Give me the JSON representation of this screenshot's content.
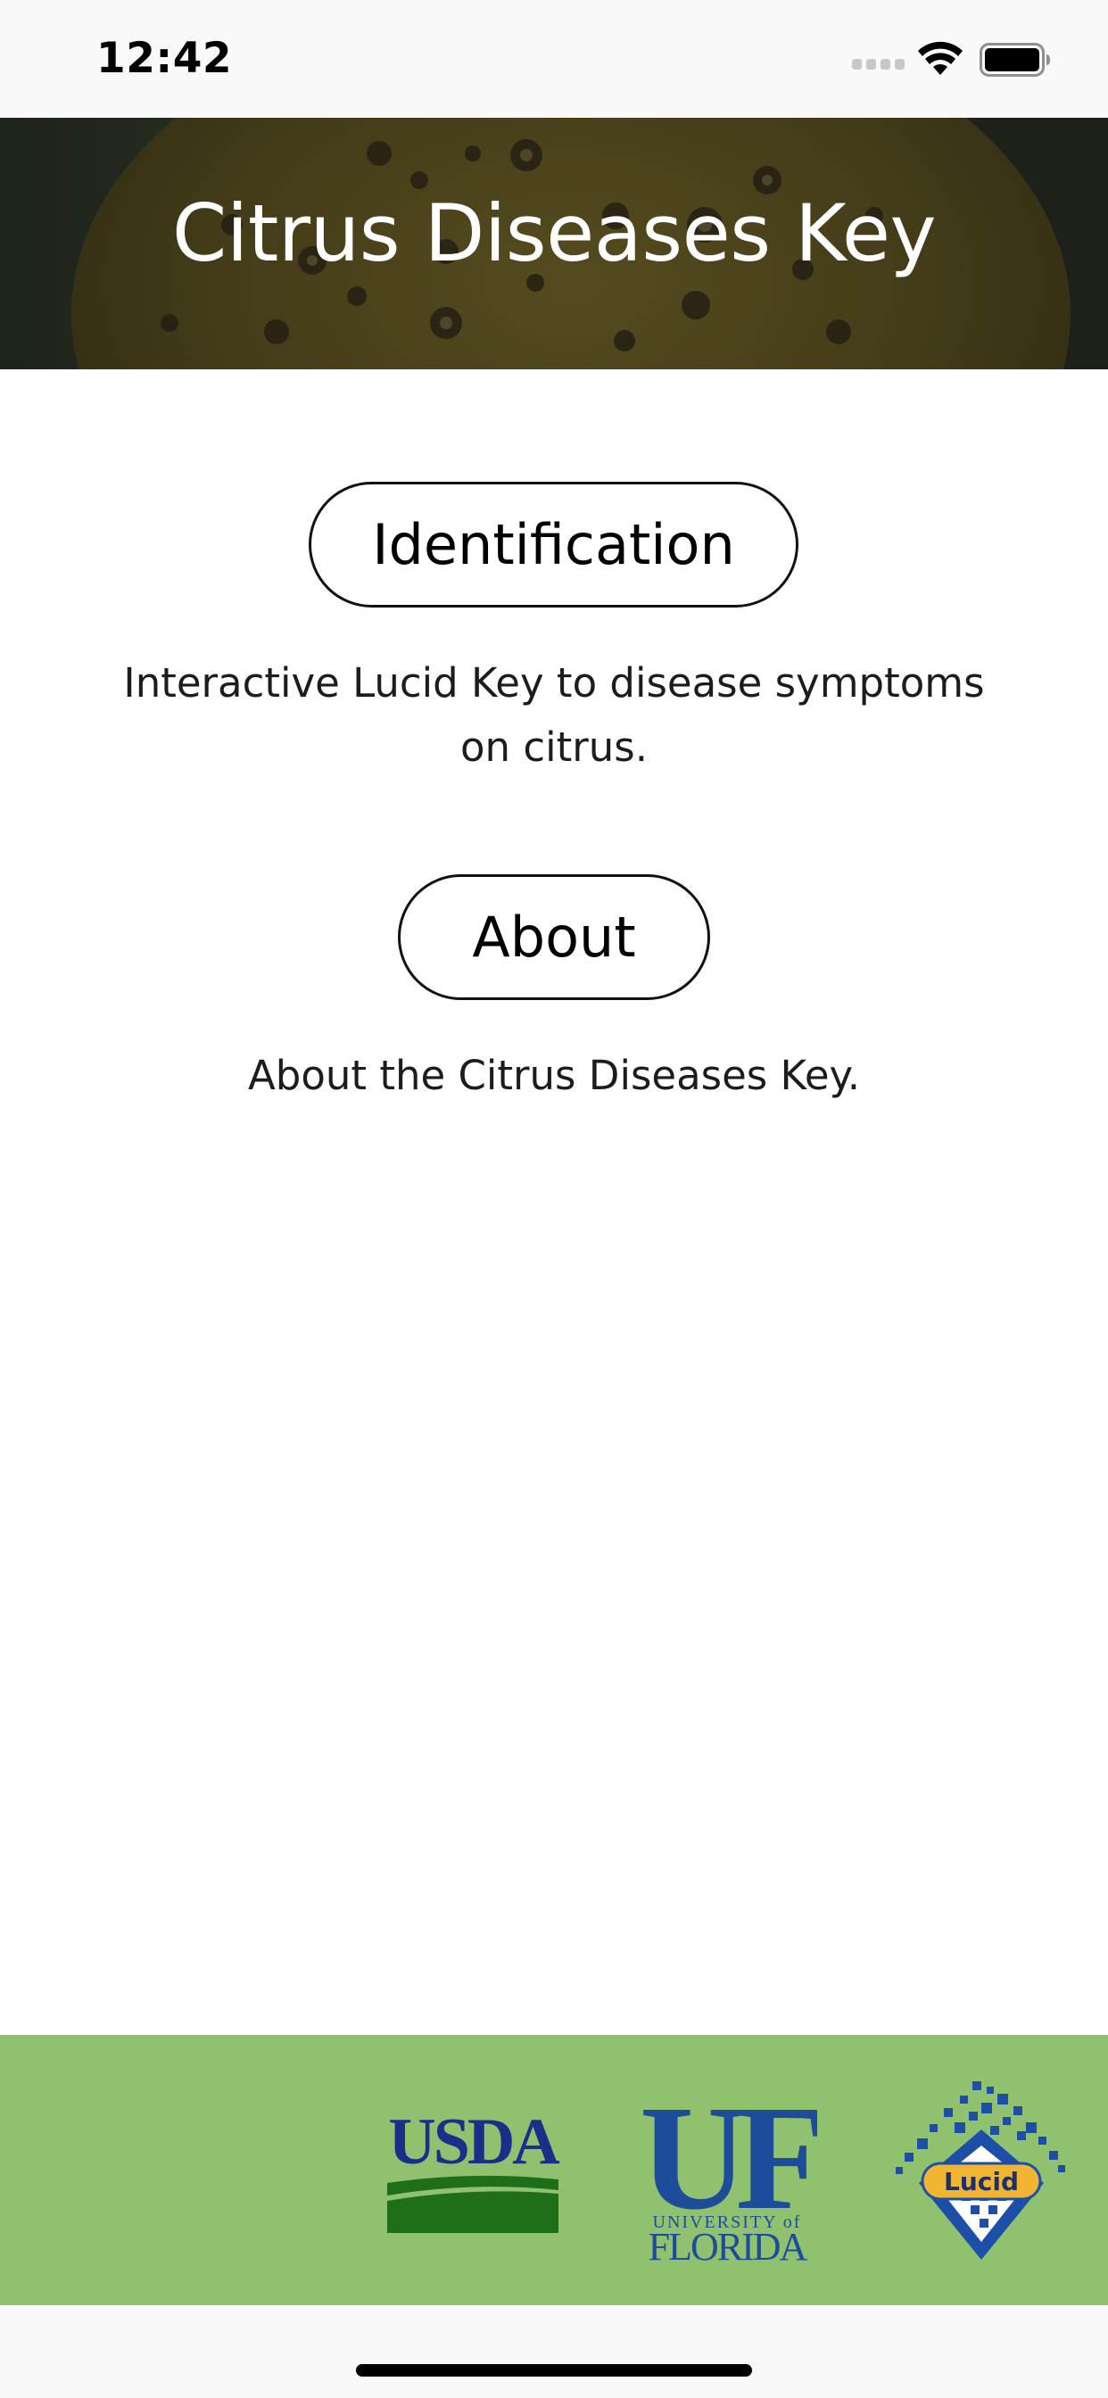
{
  "status_bar": {
    "time": "12:42",
    "icons": [
      "cellular-signal-icon",
      "wifi-icon",
      "battery-icon"
    ]
  },
  "header": {
    "title": "Citrus Diseases Key",
    "background_image": "citrus-fruit-with-disease-spots"
  },
  "main": {
    "buttons": [
      {
        "label": "Identification",
        "description": "Interactive Lucid Key to disease symptoms on citrus."
      },
      {
        "label": "About",
        "description": "About the Citrus Diseases Key."
      }
    ]
  },
  "footer": {
    "background_color": "#8fc16e",
    "logos": [
      {
        "name": "usda-logo",
        "text": "USDA"
      },
      {
        "name": "uf-logo",
        "text": "UF",
        "subtext_top": "UNIVERSITY of",
        "subtext_bottom": "FLORIDA"
      },
      {
        "name": "lucid-logo",
        "text": "Lucid"
      }
    ]
  },
  "colors": {
    "status_bar_bg": "#f9f9f9",
    "button_border": "#111111",
    "footer_bg": "#8fc16e",
    "usda_blue": "#1b2f8a",
    "usda_green": "#1e6e1a",
    "uf_blue": "#1d4d9a",
    "lucid_blue": "#1e4fa8",
    "lucid_gold": "#f2b531"
  }
}
